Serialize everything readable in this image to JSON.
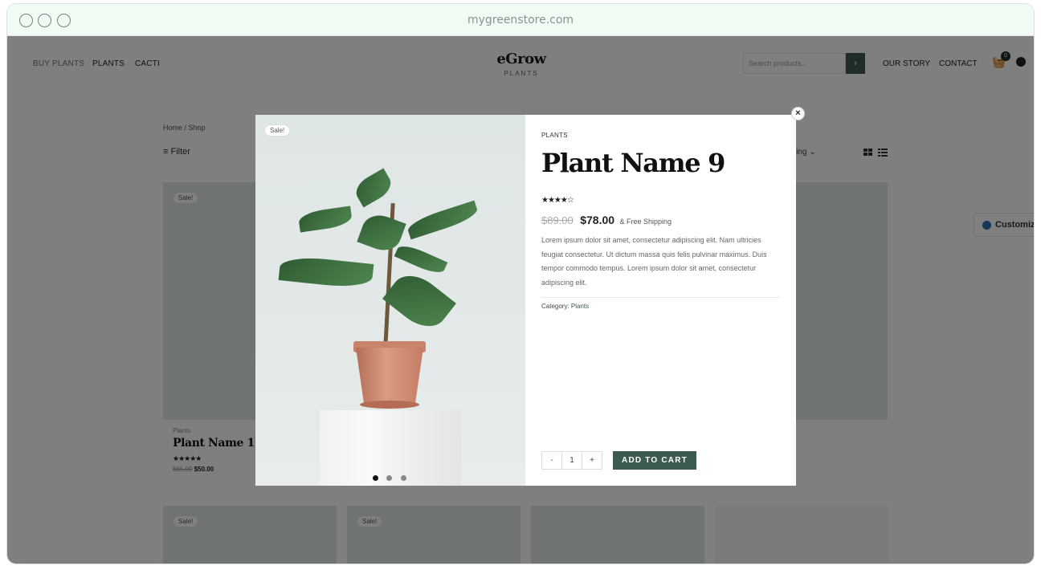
{
  "browser": {
    "url": "mygreenstore.com"
  },
  "header": {
    "nav_left": [
      "BUY PLANTS",
      "PLANTS",
      "CACTI"
    ],
    "logo_main": "eGrow",
    "logo_sub": "PLANTS",
    "search_placeholder": "Search products...",
    "nav_right": [
      "OUR STORY",
      "CONTACT"
    ],
    "cart_count": "0"
  },
  "shop": {
    "breadcrumb": "Home / Shop",
    "filter_label": "Filter",
    "sorting_label": "t sorting",
    "customize_label": "Customize",
    "featured_card": {
      "sale": "Sale!",
      "category": "Plants",
      "title": "Plant Name 1",
      "stars": "★★★★★",
      "old_price": "$65.00",
      "new_price": "$50.00"
    },
    "bottom_sales": [
      "Sale!",
      "Sale!"
    ]
  },
  "modal": {
    "sale_badge": "Sale!",
    "category_top": "PLANTS",
    "title": "Plant Name 9",
    "stars": "★★★★☆",
    "old_price": "$89.00",
    "new_price": "$78.00",
    "shipping": "& Free Shipping",
    "description": "Lorem ipsum dolor sit amet, consectetur adipiscing elit. Nam ultricies feugiat consectetur. Ut dictum massa quis felis pulvinar maximus. Duis tempor commodo tempus. Lorem ipsum dolor sit amet, consectetur adipiscing elit.",
    "category_label": "Category:",
    "category_value": "Plants",
    "qty_minus": "-",
    "qty_value": "1",
    "qty_plus": "+",
    "add_to_cart": "ADD TO CART",
    "close": "×",
    "carousel_active": 1
  }
}
